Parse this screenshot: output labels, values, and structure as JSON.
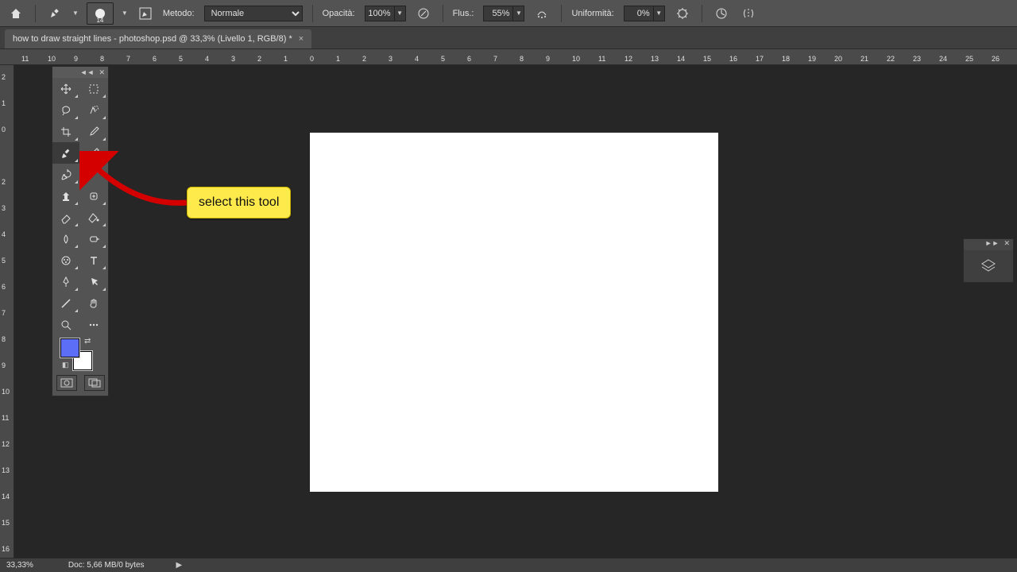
{
  "topbar": {
    "brush_size": "14",
    "method_label": "Metodo:",
    "method_value": "Normale",
    "opacity_label": "Opacità:",
    "opacity_value": "100%",
    "flow_label": "Flus.:",
    "flow_value": "55%",
    "smoothness_label": "Uniformità:",
    "smoothness_value": "0%"
  },
  "doc_tab": {
    "title": "how to draw straight lines - photoshop.psd @ 33,3% (Livello 1, RGB/8) *",
    "close": "×"
  },
  "h_ruler": [
    "11",
    "10",
    "9",
    "8",
    "7",
    "6",
    "5",
    "4",
    "3",
    "2",
    "1",
    "0",
    "1",
    "2",
    "3",
    "4",
    "5",
    "6",
    "7",
    "8",
    "9",
    "10",
    "11",
    "12",
    "13",
    "14",
    "15",
    "16",
    "17",
    "18",
    "19",
    "20",
    "21",
    "22",
    "23",
    "24",
    "25",
    "26"
  ],
  "v_ruler_top": [
    "2",
    "1",
    "0"
  ],
  "v_ruler_bottom": [
    "2",
    "3",
    "4",
    "5",
    "6",
    "7",
    "8",
    "9",
    "10",
    "11",
    "12",
    "13",
    "14",
    "15",
    "16"
  ],
  "tools": [
    [
      "move-tool",
      "marquee-tool"
    ],
    [
      "lasso-tool",
      "quick-select-tool"
    ],
    [
      "crop-tool",
      "eyedropper-tool"
    ],
    [
      "brush-tool",
      "pencil-tool"
    ],
    [
      "history-brush-tool",
      ""
    ],
    [
      "clone-stamp-tool",
      "healing-brush-tool"
    ],
    [
      "eraser-tool",
      "paint-bucket-tool"
    ],
    [
      "blur-tool",
      "dodge-tool"
    ],
    [
      "mixer-brush-tool",
      "type-tool"
    ],
    [
      "pen-tool",
      "path-select-tool"
    ],
    [
      "line-tool",
      "hand-tool"
    ],
    [
      "zoom-tool",
      "more-tool"
    ]
  ],
  "colors": {
    "foreground": "#5b6ef5",
    "background": "#ffffff"
  },
  "status": {
    "zoom": "33,33%",
    "docinfo": "Doc: 5,66 MB/0 bytes"
  },
  "callout": {
    "text": "select this tool"
  },
  "toolbox_head": {
    "collapse": "◄◄",
    "close": "✕"
  },
  "layers_head": {
    "expand": "►►",
    "close": "✕"
  }
}
